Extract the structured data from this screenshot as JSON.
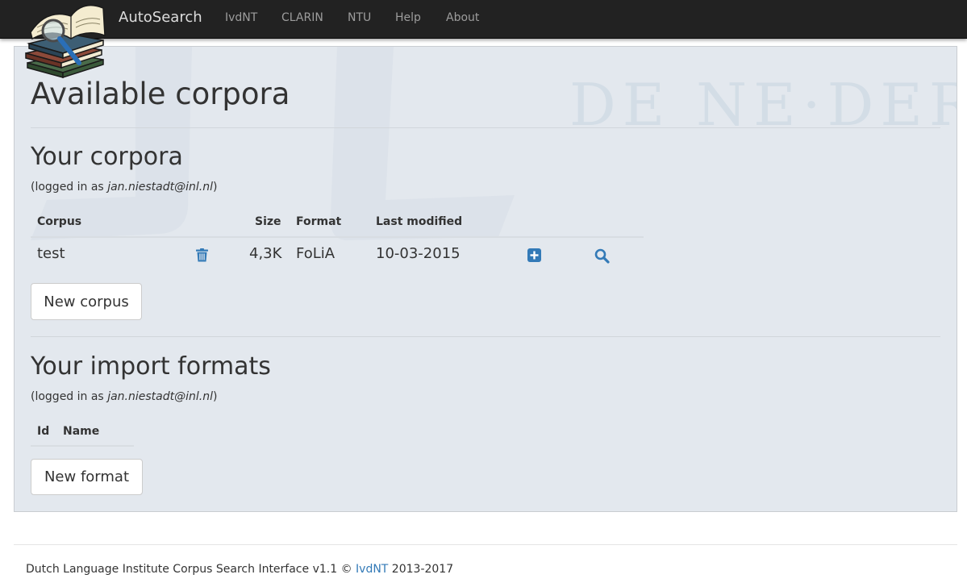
{
  "navbar": {
    "brand": "AutoSearch",
    "links": [
      "IvdNT",
      "CLARIN",
      "NTU",
      "Help",
      "About"
    ]
  },
  "watermark": {
    "text": "DE NE·DER·L"
  },
  "main": {
    "title": "Available corpora",
    "corpora_section": {
      "title": "Your corpora",
      "logged_in_prefix": "(logged in as ",
      "user": "jan.niestadt@inl.nl",
      "logged_in_suffix": ")",
      "columns": [
        "Corpus",
        "Size",
        "Format",
        "Last modified"
      ],
      "rows": [
        {
          "corpus": "test",
          "size": "4,3K",
          "format": "FoLiA",
          "last_modified": "10-03-2015"
        }
      ],
      "new_button": "New corpus"
    },
    "formats_section": {
      "title": "Your import formats",
      "logged_in_prefix": "(logged in as ",
      "user": "jan.niestadt@inl.nl",
      "logged_in_suffix": ")",
      "columns": [
        "Id",
        "Name"
      ],
      "new_button": "New format"
    }
  },
  "footer": {
    "text_before": "Dutch Language Institute Corpus Search Interface v1.1 © ",
    "link": "IvdNT",
    "text_after": " 2013-2017"
  },
  "colors": {
    "navbar_bg": "#222222",
    "well_bg": "#e3e8ee",
    "icon_blue": "#337ab7",
    "link_blue": "#337ab7"
  },
  "icons": {
    "logo": "books-magnifier-logo",
    "delete": "trash-icon",
    "add": "plus-square-icon",
    "search": "search-icon"
  }
}
